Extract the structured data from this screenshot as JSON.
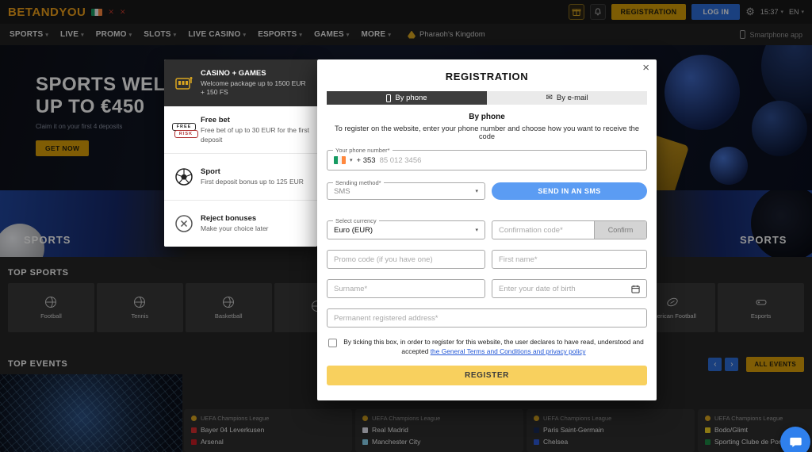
{
  "header": {
    "logo": "BETANDYOU",
    "registration_button": "REGISTRATION",
    "login_button": "LOG IN",
    "time": "15:37",
    "language": "EN"
  },
  "nav": {
    "items": [
      "SPORTS",
      "LIVE",
      "PROMO",
      "SLOTS",
      "LIVE CASINO",
      "ESPORTS",
      "GAMES",
      "MORE"
    ],
    "featured": "Pharaoh's Kingdom",
    "app_link": "Smartphone app"
  },
  "hero": {
    "title_line1": "SPORTS WELCOME",
    "title_line2": "UP TO €450",
    "subtitle": "Claim it on your first 4 deposits",
    "cta": "GET NOW"
  },
  "side_panels": {
    "left_label": "SPORTS",
    "right_label": "SPORTS"
  },
  "top_sports": {
    "heading": "TOP SPORTS",
    "items": [
      "Football",
      "Tennis",
      "Basketball",
      "",
      "",
      "",
      "",
      "American Football",
      "Esports"
    ]
  },
  "top_events": {
    "heading": "TOP EVENTS",
    "all_events_button": "ALL EVENTS",
    "cards": [
      {
        "league": "UEFA Champions League",
        "team1": "Bayer 04 Leverkusen",
        "team2": "Arsenal",
        "team1_color": "#d63031",
        "team2_color": "#c81d25"
      },
      {
        "league": "UEFA Champions League",
        "team1": "Real Madrid",
        "team2": "Manchester City",
        "team1_color": "#e9e9f5",
        "team2_color": "#8ad4f0"
      },
      {
        "league": "UEFA Champions League",
        "team1": "Paris Saint-Germain",
        "team2": "Chelsea",
        "team1_color": "#1b2b56",
        "team2_color": "#2e5bd7"
      },
      {
        "league": "UEFA Champions League",
        "team1": "Bodo/Glimt",
        "team2": "Sporting Clube de Portugal",
        "team1_color": "#f2d024",
        "team2_color": "#1e8a46"
      }
    ]
  },
  "bonus_panel": {
    "items": [
      {
        "title": "CASINO + GAMES",
        "description": "Welcome package up to 1500 EUR + 150 FS"
      },
      {
        "title": "Free bet",
        "description": "Free bet of up to 30 EUR for the first deposit",
        "icon_line1": "FREE",
        "icon_line2": "RISK"
      },
      {
        "title": "Sport",
        "description": "First deposit bonus up to 125 EUR"
      },
      {
        "title": "Reject bonuses",
        "description": "Make your choice later"
      }
    ]
  },
  "modal": {
    "title": "REGISTRATION",
    "tabs": {
      "phone": "By phone",
      "email": "By e-mail"
    },
    "section_heading": "By phone",
    "description": "To register on the website, enter your phone number and choose how you want to receive the code",
    "phone": {
      "label": "Your phone number*",
      "code": "+ 353",
      "placeholder": "85 012 3456"
    },
    "sending_method": {
      "label": "Sending method*",
      "value": "SMS"
    },
    "send_sms_button": "SEND IN AN SMS",
    "currency": {
      "label": "Select currency",
      "value": "Euro (EUR)"
    },
    "confirmation": {
      "placeholder": "Confirmation code*",
      "button": "Confirm"
    },
    "promo_placeholder": "Promo code (if you have one)",
    "first_name_placeholder": "First name*",
    "surname_placeholder": "Surname*",
    "dob_placeholder": "Enter your date of birth",
    "address_placeholder": "Permanent registered address*",
    "terms_text": "By ticking this box, in order to register for this website, the user declares to have read, understood and accepted",
    "terms_link": "the General Terms and Conditions and privacy policy",
    "register_button": "REGISTER"
  },
  "colors": {
    "brand_yellow": "#d89f07",
    "accent_blue": "#2d6fdb",
    "send_button_blue": "#5b9cf3",
    "register_yellow": "#f8d05e",
    "link_blue": "#2156d6",
    "league_gold": "#d9a520"
  }
}
